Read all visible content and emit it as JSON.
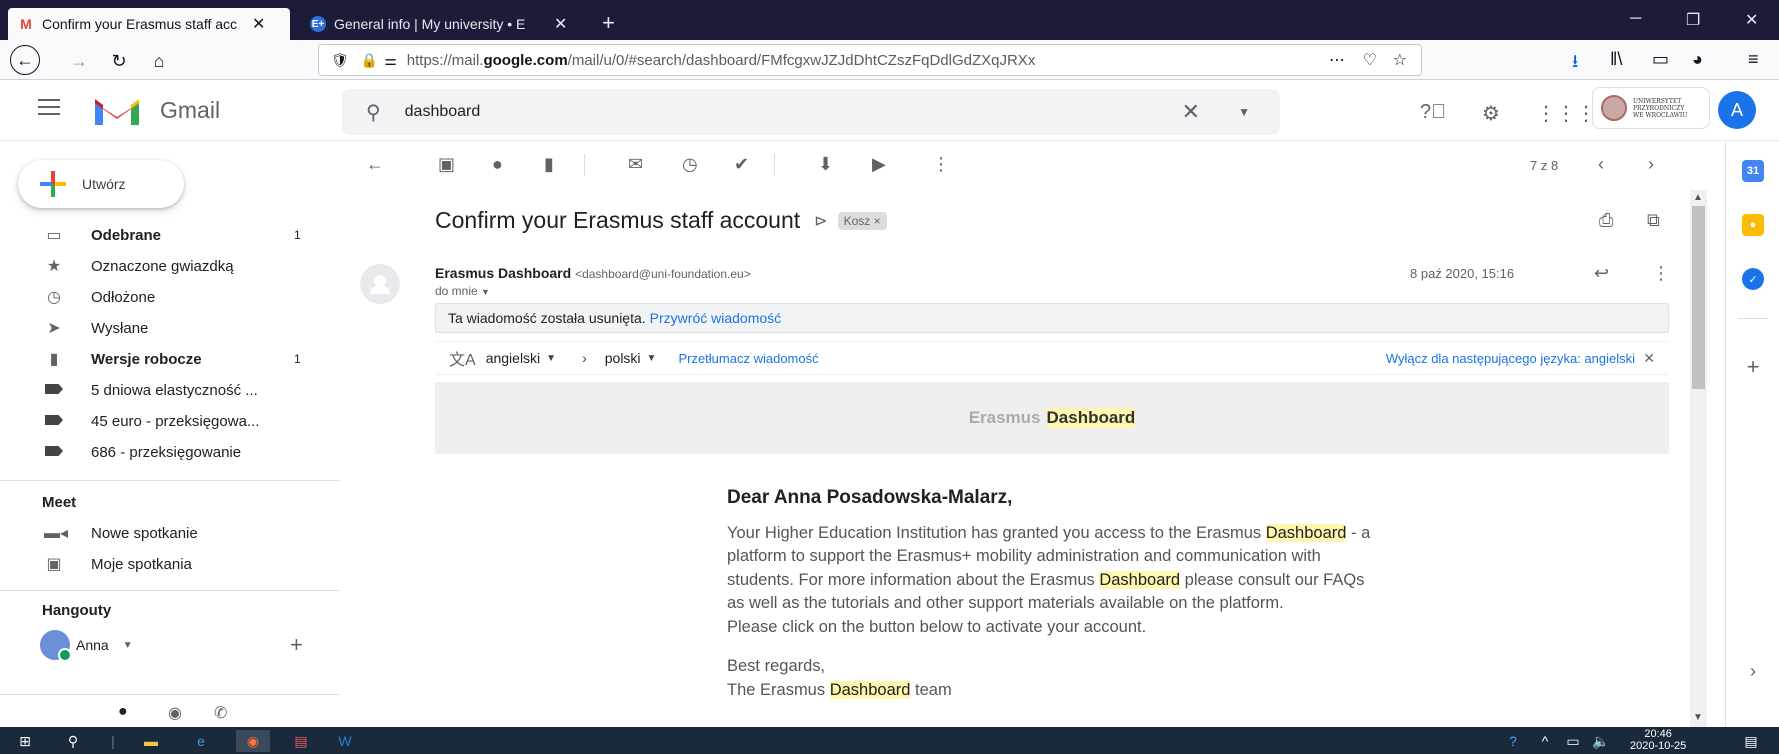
{
  "browser": {
    "tabs": [
      {
        "title": "Confirm your Erasmus staff acc",
        "favicon": "gmail-icon",
        "active": true
      },
      {
        "title": "General info | My university • E",
        "favicon": "erasmus-icon",
        "active": false
      }
    ],
    "url_prefix": "https://mail.",
    "url_domain": "google.com",
    "url_suffix": "/mail/u/0/#search/dashboard/FMfcgxwJZJdDhtCZszFqDdlGdZXqJRXx",
    "url_more": "⋯"
  },
  "gmail": {
    "brand": "Gmail",
    "search_value": "dashboard",
    "compose_label": "Utwórz",
    "nav": [
      {
        "label": "Odebrane",
        "count": "1",
        "bold": true,
        "icon": "inbox-icon"
      },
      {
        "label": "Oznaczone gwiazdką",
        "count": "",
        "bold": false,
        "icon": "star-icon"
      },
      {
        "label": "Odłożone",
        "count": "",
        "bold": false,
        "icon": "clock-icon"
      },
      {
        "label": "Wysłane",
        "count": "",
        "bold": false,
        "icon": "send-icon"
      },
      {
        "label": "Wersje robocze",
        "count": "1",
        "bold": true,
        "icon": "draft-icon"
      },
      {
        "label": "5 dniowa elastyczność ...",
        "count": "",
        "bold": false,
        "icon": "label-icon"
      },
      {
        "label": "45 euro - przeksięgowa...",
        "count": "",
        "bold": false,
        "icon": "label-icon"
      },
      {
        "label": "686 - przeksięgowanie",
        "count": "",
        "bold": false,
        "icon": "label-icon"
      }
    ],
    "meet_title": "Meet",
    "meet_items": [
      {
        "label": "Nowe spotkanie",
        "icon": "video-icon"
      },
      {
        "label": "Moje spotkania",
        "icon": "calendar-icon"
      }
    ],
    "hangouts_title": "Hangouty",
    "hangouts_user": "Anna",
    "account_initial": "A",
    "uni_logo_text": [
      "UNIWERSYTET",
      "PRZYRODNICZY",
      "WE WROCŁAWIU"
    ],
    "page_count": "7 z 8"
  },
  "message": {
    "subject": "Confirm your Erasmus staff account",
    "label_chip": "Kosz ×",
    "sender_name": "Erasmus Dashboard",
    "sender_email": "<dashboard@uni-foundation.eu>",
    "to": "do mnie",
    "date": "8 paź 2020, 15:16",
    "deleted_notice": "Ta wiadomość została usunięta.",
    "restore_link": "Przywróć wiadomość",
    "translate": {
      "from_lang": "angielski",
      "to_lang": "polski",
      "translate_link": "Przetłumacz wiadomość",
      "disable_link": "Wyłącz dla następującego języka: angielski"
    },
    "banner_part1": "Erasmus",
    "banner_part2": "Dashboard",
    "greeting": "Dear Anna Posadowska-Malarz,",
    "para1_a": "Your Higher Education Institution has granted you access to the Erasmus ",
    "hl1": "Dashboard",
    "para1_b": " - a platform to support the Erasmus+ mobility administration and communication with students. For more information about the Erasmus ",
    "hl2": "Dashboard",
    "para1_c": " please consult our FAQs as well as the tutorials and other support materials available on the platform.",
    "para2": "Please click on the button below to activate your account.",
    "regards1": "Best regards,",
    "regards2_a": "The Erasmus ",
    "hl3": "Dashboard",
    "regards2_b": " team"
  },
  "taskbar": {
    "time": "20:46",
    "date": "2020-10-25"
  },
  "colors": {
    "accent_blue": "#1a73e8",
    "highlight": "#fff7b0",
    "tabstrip": "#1c1b3a",
    "taskbar": "#1a2a3c"
  }
}
